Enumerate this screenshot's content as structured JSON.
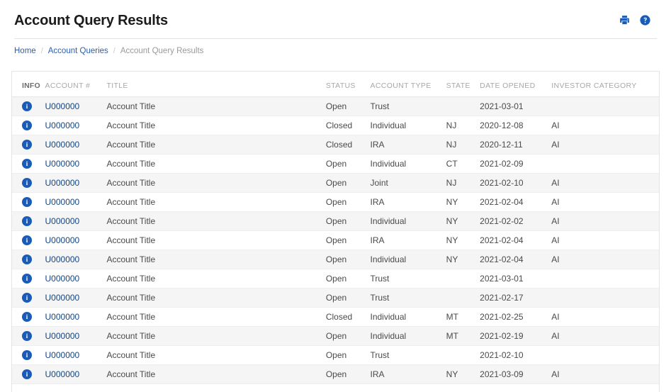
{
  "header": {
    "title": "Account Query Results",
    "actions": [
      {
        "name": "print-icon",
        "label": "Print"
      },
      {
        "name": "help-icon",
        "label": "Help"
      }
    ],
    "accent_color": "#1a5bb8"
  },
  "breadcrumb": {
    "items": [
      {
        "label": "Home",
        "current": false
      },
      {
        "label": "Account Queries",
        "current": false
      },
      {
        "label": "Account Query Results",
        "current": true
      }
    ],
    "separator": "/",
    "link_color": "#2f5fa8",
    "current_color": "#9a9a9a"
  },
  "table": {
    "columns": [
      "INFO",
      "ACCOUNT #",
      "TITLE",
      "STATUS",
      "ACCOUNT TYPE",
      "STATE",
      "DATE OPENED",
      "INVESTOR CATEGORY"
    ],
    "info_icon_label": "i",
    "rows": [
      {
        "account": "U000000",
        "title": "Account Title",
        "status": "Open",
        "type": "Trust",
        "state": "",
        "date_opened": "2021-03-01",
        "investor_category": ""
      },
      {
        "account": "U000000",
        "title": "Account Title",
        "status": "Closed",
        "type": "Individual",
        "state": "NJ",
        "date_opened": "2020-12-08",
        "investor_category": "AI"
      },
      {
        "account": "U000000",
        "title": "Account Title",
        "status": "Closed",
        "type": "IRA",
        "state": "NJ",
        "date_opened": "2020-12-11",
        "investor_category": "AI"
      },
      {
        "account": "U000000",
        "title": "Account Title",
        "status": "Open",
        "type": "Individual",
        "state": "CT",
        "date_opened": "2021-02-09",
        "investor_category": ""
      },
      {
        "account": "U000000",
        "title": "Account Title",
        "status": "Open",
        "type": "Joint",
        "state": "NJ",
        "date_opened": "2021-02-10",
        "investor_category": "AI"
      },
      {
        "account": "U000000",
        "title": "Account Title",
        "status": "Open",
        "type": "IRA",
        "state": "NY",
        "date_opened": "2021-02-04",
        "investor_category": "AI"
      },
      {
        "account": "U000000",
        "title": "Account Title",
        "status": "Open",
        "type": "Individual",
        "state": "NY",
        "date_opened": "2021-02-02",
        "investor_category": "AI"
      },
      {
        "account": "U000000",
        "title": "Account Title",
        "status": "Open",
        "type": "IRA",
        "state": "NY",
        "date_opened": "2021-02-04",
        "investor_category": "AI"
      },
      {
        "account": "U000000",
        "title": "Account Title",
        "status": "Open",
        "type": "Individual",
        "state": "NY",
        "date_opened": "2021-02-04",
        "investor_category": "AI"
      },
      {
        "account": "U000000",
        "title": "Account Title",
        "status": "Open",
        "type": "Trust",
        "state": "",
        "date_opened": "2021-03-01",
        "investor_category": ""
      },
      {
        "account": "U000000",
        "title": "Account Title",
        "status": "Open",
        "type": "Trust",
        "state": "",
        "date_opened": "2021-02-17",
        "investor_category": ""
      },
      {
        "account": "U000000",
        "title": "Account Title",
        "status": "Closed",
        "type": "Individual",
        "state": "MT",
        "date_opened": "2021-02-25",
        "investor_category": "AI"
      },
      {
        "account": "U000000",
        "title": "Account Title",
        "status": "Open",
        "type": "Individual",
        "state": "MT",
        "date_opened": "2021-02-19",
        "investor_category": "AI"
      },
      {
        "account": "U000000",
        "title": "Account Title",
        "status": "Open",
        "type": "Trust",
        "state": "",
        "date_opened": "2021-02-10",
        "investor_category": ""
      },
      {
        "account": "U000000",
        "title": "Account Title",
        "status": "Open",
        "type": "IRA",
        "state": "NY",
        "date_opened": "2021-03-09",
        "investor_category": "AI"
      }
    ]
  }
}
